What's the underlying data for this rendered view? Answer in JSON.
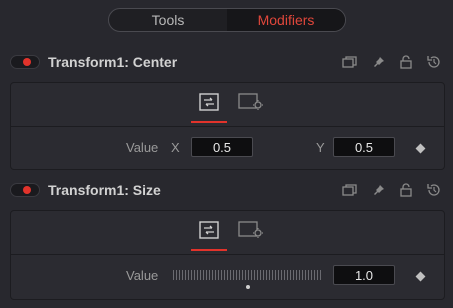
{
  "tabs": [
    {
      "label": "Tools",
      "active": false
    },
    {
      "label": "Modifiers",
      "active": true
    }
  ],
  "modifiers": [
    {
      "title": "Transform1: Center",
      "enabled": true,
      "value_label": "Value",
      "x_label": "X",
      "x_value": "0.5",
      "y_label": "Y",
      "y_value": "0.5"
    },
    {
      "title": "Transform1: Size",
      "enabled": true,
      "value_label": "Value",
      "value": "1.0",
      "slider_level": 0.5
    }
  ],
  "colors": {
    "accent": "#e2332b",
    "background": "#28282e",
    "panel": "#2b2b31",
    "field": "#0e0e10"
  },
  "icons": {
    "header": [
      "duplicate-icon",
      "pin-icon",
      "lock-icon",
      "reset-icon"
    ],
    "subtabs": [
      "controls-icon",
      "settings-icon"
    ]
  }
}
